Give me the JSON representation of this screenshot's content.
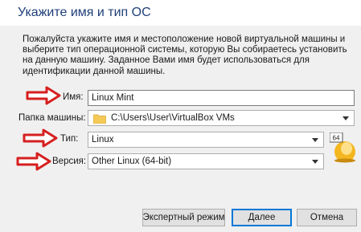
{
  "window": {
    "title": "Укажите имя и тип ОС"
  },
  "description": "Пожалуйста укажите имя и местоположение новой виртуальной машины и выберите тип операционной системы, которую Вы собираетесь установить на данную машину. Заданное Вами имя будет использоваться для идентификации данной машины.",
  "form": {
    "name_label": "Имя:",
    "name_value": "Linux Mint",
    "folder_label": "Папка машины:",
    "folder_value": "C:\\Users\\User\\VirtualBox VMs",
    "type_label": "Тип:",
    "type_value": "Linux",
    "version_label": "Версия:",
    "version_value": "Other Linux (64-bit)",
    "os_badge": "64"
  },
  "buttons": {
    "expert": "Экспертный режим",
    "next": "Далее",
    "cancel": "Отмена"
  },
  "colors": {
    "title": "#1f3f7a",
    "arrow": "#d61f1f",
    "focus": "#0078d7"
  },
  "icons": [
    "red-arrow-icon",
    "folder-icon",
    "chevron-down-icon",
    "linux-64-icon"
  ]
}
